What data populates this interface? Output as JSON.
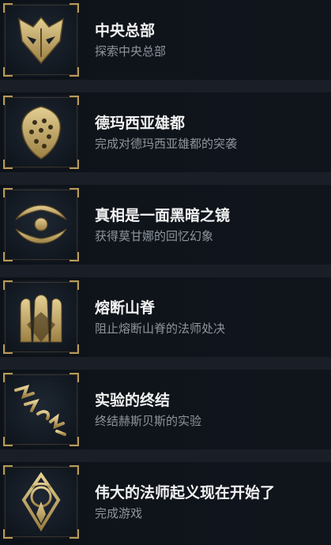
{
  "achievements": [
    {
      "title": "中央总部",
      "description": "探索中央总部",
      "icon": "mask-emblem-icon"
    },
    {
      "title": "德玛西亚雄都",
      "description": "完成对德玛西亚雄都的突袭",
      "icon": "shield-emblem-icon"
    },
    {
      "title": "真相是一面黑暗之镜",
      "description": "获得莫甘娜的回忆幻象",
      "icon": "eye-emblem-icon"
    },
    {
      "title": "熔断山脊",
      "description": "阻止熔断山脊的法师处决",
      "icon": "statues-emblem-icon"
    },
    {
      "title": "实验的终结",
      "description": "终结赫斯贝斯的实验",
      "icon": "broken-runes-emblem-icon"
    },
    {
      "title": "伟大的法师起义现在开始了",
      "description": "完成游戏",
      "icon": "mage-sigil-emblem-icon"
    }
  ],
  "colors": {
    "gold": "#c9ad6a",
    "title": "#f2f2f2",
    "description": "#8f959c",
    "row_bg": "#0f141b"
  }
}
